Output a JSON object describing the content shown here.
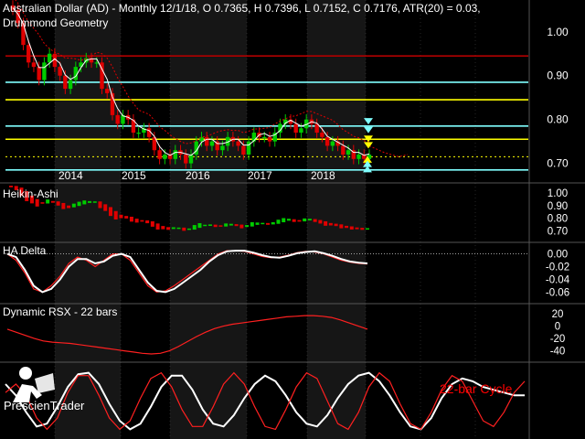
{
  "header": {
    "line1": "Australian Dollar (AD) - Monthly 12/1/18, O 0.7365, H 0.7396, L 0.7152, C 0.7176, ATR(20) = 0.03,",
    "line2": "Drummond Geometry"
  },
  "branding": {
    "logo_text": "PrescienTrader",
    "logo_icon": "reading-figure-icon"
  },
  "colors": {
    "background": "#000000",
    "up": "#00cc00",
    "down": "#e00000",
    "yellow_line": "#ffff00",
    "cyan_line": "#80ffff",
    "darkred_line": "#b00000",
    "grid": "#404040",
    "axis_text": "#ffffff",
    "ha_red": "#ff2020",
    "ha_white": "#ffffff",
    "rsx": "#e00000",
    "cycle_label": "#ff0000"
  },
  "chart_data": [
    {
      "panel": "price",
      "type": "candlestick",
      "title": "Australian Dollar (AD) - Monthly",
      "x_tick_labels": [
        "2014",
        "2015",
        "2016",
        "2017",
        "2018"
      ],
      "y_tick_labels": [
        "1.00",
        "0.90",
        "0.80",
        "0.70"
      ],
      "ylim": [
        0.67,
        1.06
      ],
      "horizontal_levels": [
        {
          "value": 0.945,
          "color": "darkred"
        },
        {
          "value": 0.885,
          "color": "cyan"
        },
        {
          "value": 0.845,
          "color": "yellow"
        },
        {
          "value": 0.785,
          "color": "cyan"
        },
        {
          "value": 0.755,
          "color": "yellow"
        },
        {
          "value": 0.715,
          "color": "yellow-dotted"
        },
        {
          "value": 0.685,
          "color": "cyan"
        }
      ],
      "closes": [
        1.05,
        1.02,
        0.97,
        0.93,
        0.92,
        0.89,
        0.93,
        0.95,
        0.92,
        0.9,
        0.87,
        0.89,
        0.92,
        0.93,
        0.94,
        0.93,
        0.93,
        0.87,
        0.86,
        0.81,
        0.79,
        0.81,
        0.8,
        0.77,
        0.77,
        0.78,
        0.76,
        0.73,
        0.71,
        0.72,
        0.71,
        0.73,
        0.72,
        0.7,
        0.72,
        0.75,
        0.76,
        0.74,
        0.75,
        0.73,
        0.74,
        0.76,
        0.75,
        0.74,
        0.72,
        0.75,
        0.77,
        0.76,
        0.76,
        0.75,
        0.77,
        0.79,
        0.8,
        0.79,
        0.77,
        0.78,
        0.8,
        0.79,
        0.77,
        0.76,
        0.74,
        0.75,
        0.74,
        0.72,
        0.73,
        0.71,
        0.72,
        0.71,
        0.72
      ]
    },
    {
      "panel": "heikin-ashi",
      "type": "candlestick",
      "title": "Heikin-Ashi",
      "y_tick_labels": [
        "1.00",
        "0.90",
        "0.80",
        "0.70"
      ],
      "ylim": [
        0.66,
        1.03
      ]
    },
    {
      "panel": "ha-delta",
      "type": "line",
      "title": "HA Delta",
      "y_tick_labels": [
        "0.00",
        "-0.02",
        "-0.04",
        "-0.06"
      ],
      "ylim": [
        -0.068,
        0.008
      ],
      "series": [
        {
          "color": "red",
          "values": [
            0.0,
            -0.01,
            -0.03,
            -0.055,
            -0.06,
            -0.05,
            -0.035,
            -0.015,
            -0.005,
            -0.01,
            -0.02,
            -0.01,
            0.0,
            0.0,
            -0.01,
            -0.03,
            -0.05,
            -0.06,
            -0.058,
            -0.05,
            -0.04,
            -0.03,
            -0.02,
            -0.01,
            0.0,
            0.005,
            0.005,
            0.004,
            0.0,
            -0.004,
            -0.006,
            -0.005,
            -0.002,
            0.002,
            0.004,
            0.003,
            0.0,
            -0.005,
            -0.01,
            -0.013,
            -0.015,
            -0.016
          ]
        },
        {
          "color": "white",
          "values": [
            0.0,
            -0.005,
            -0.025,
            -0.05,
            -0.06,
            -0.055,
            -0.04,
            -0.02,
            -0.008,
            -0.008,
            -0.015,
            -0.012,
            -0.003,
            0.0,
            -0.005,
            -0.025,
            -0.045,
            -0.058,
            -0.06,
            -0.055,
            -0.045,
            -0.035,
            -0.025,
            -0.012,
            -0.002,
            0.004,
            0.005,
            0.005,
            0.002,
            -0.002,
            -0.005,
            -0.006,
            -0.003,
            0.001,
            0.003,
            0.004,
            0.001,
            -0.003,
            -0.008,
            -0.012,
            -0.014,
            -0.015
          ]
        }
      ]
    },
    {
      "panel": "rsx",
      "type": "line",
      "title": "Dynamic RSX - 22 bars",
      "y_tick_labels": [
        "20",
        "0",
        "-20",
        "-40"
      ],
      "ylim": [
        -48,
        26
      ],
      "series": [
        {
          "color": "red",
          "values": [
            -5,
            -10,
            -15,
            -20,
            -24,
            -26,
            -27,
            -28,
            -30,
            -32,
            -34,
            -36,
            -38,
            -40,
            -42,
            -44,
            -45,
            -44,
            -40,
            -33,
            -25,
            -17,
            -10,
            -4,
            0,
            3,
            5,
            7,
            9,
            11,
            13,
            15,
            16,
            17,
            17,
            16,
            14,
            10,
            5,
            0,
            -5
          ]
        }
      ]
    },
    {
      "panel": "cycle",
      "type": "line",
      "title": "",
      "annotation": "22-bar Cycle",
      "y_tick_labels": [],
      "ylim": [
        -1.15,
        1.15
      ],
      "series": [
        {
          "color": "white",
          "values": [
            0.6,
            0.2,
            -0.4,
            -0.9,
            -0.8,
            -0.2,
            0.5,
            0.95,
            1.0,
            0.6,
            -0.1,
            -0.7,
            -1.0,
            -0.8,
            -0.2,
            0.5,
            0.9,
            0.9,
            0.4,
            -0.3,
            -0.8,
            -0.9,
            -0.5,
            0.1,
            0.6,
            0.9,
            0.7,
            0.2,
            -0.4,
            -0.8,
            -0.9,
            -0.5,
            0.1,
            0.6,
            0.9,
            1.0,
            0.7,
            0.2,
            -0.4,
            -0.9,
            -1.0,
            -0.6,
            0.1,
            0.6,
            0.8,
            0.7,
            0.5,
            0.4,
            0.3,
            0.2,
            0.2
          ]
        },
        {
          "color": "red",
          "values": [
            0.3,
            0.6,
            0.2,
            -0.6,
            -1.0,
            -0.6,
            0.3,
            0.9,
            0.9,
            0.2,
            -0.6,
            -1.0,
            -0.7,
            0.1,
            0.8,
            1.0,
            0.5,
            -0.3,
            -0.9,
            -0.9,
            -0.2,
            0.6,
            1.0,
            0.6,
            -0.2,
            -0.9,
            -1.0,
            -0.3,
            0.5,
            1.0,
            0.8,
            0.0,
            -0.8,
            -1.0,
            -0.4,
            0.5,
            1.0,
            0.7,
            -0.1,
            -0.8,
            -1.0,
            -0.4,
            0.4,
            0.9,
            0.7,
            0.0,
            -0.7,
            -0.9,
            -0.4,
            0.3,
            0.7
          ]
        }
      ]
    }
  ]
}
